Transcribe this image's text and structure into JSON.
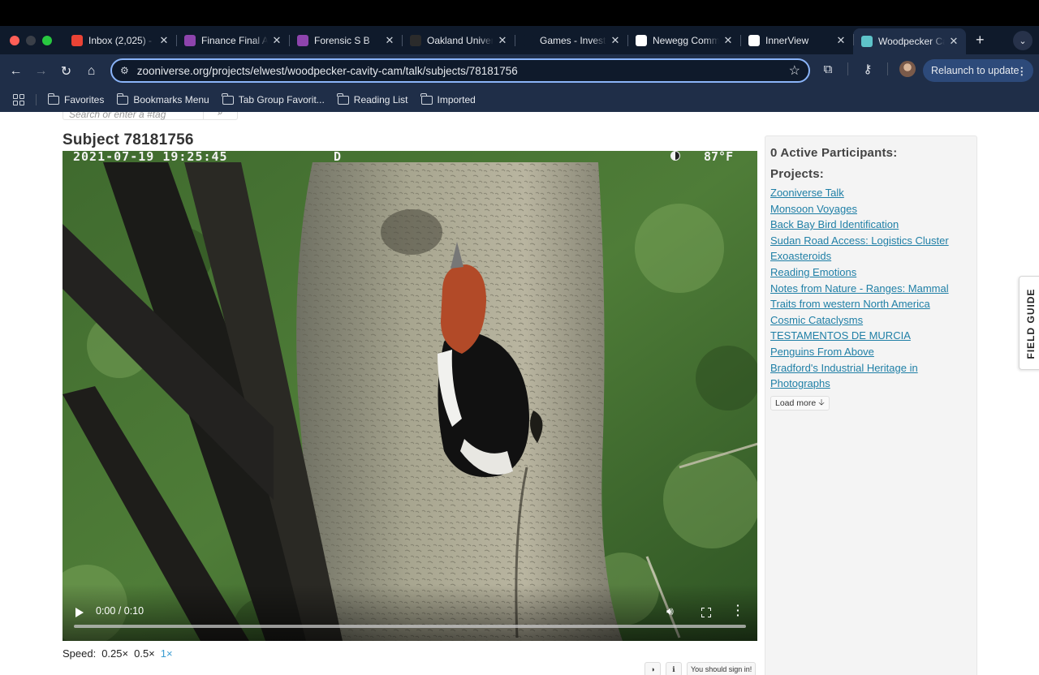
{
  "browser": {
    "tabs": [
      {
        "title": "Inbox (2,025) -",
        "favicon": "gmail-icon",
        "fav_color": "#ea4335"
      },
      {
        "title": "Finance Final A",
        "favicon": "canvas-icon",
        "fav_color": "#8e44ad"
      },
      {
        "title": "Forensic S B",
        "favicon": "canvas-icon",
        "fav_color": "#8e44ad"
      },
      {
        "title": "Oakland Univer",
        "favicon": "oakland-icon",
        "fav_color": "#2b2b2b"
      },
      {
        "title": "Games - Investi",
        "favicon": "investing-icon",
        "fav_color": "#0f1a2b"
      },
      {
        "title": "Newegg Comm",
        "favicon": "newegg-icon",
        "fav_color": "#ffffff"
      },
      {
        "title": "InnerView",
        "favicon": "innerview-icon",
        "fav_color": "#ffffff"
      },
      {
        "title": "Woodpecker Ca",
        "favicon": "zooniverse-icon",
        "fav_color": "#5ec3c9",
        "active": true
      }
    ],
    "new_tab": "+",
    "url": "zooniverse.org/projects/elwest/woodpecker-cavity-cam/talk/subjects/78181756",
    "relaunch_label": "Relaunch to update",
    "bookmarks": [
      "Favorites",
      "Bookmarks Menu",
      "Tab Group Favorit...",
      "Reading List",
      "Imported"
    ]
  },
  "page": {
    "search_placeholder": "Search or enter a #tag",
    "subject_title": "Subject 78181756",
    "video": {
      "timestamp": "2021-07-19 19:25:45",
      "mode": "D",
      "temperature": "87°F",
      "time": "0:00 / 0:10",
      "progress": 0
    },
    "speed": {
      "label": "Speed:",
      "options": [
        "0.25×",
        "0.5×",
        "1×"
      ],
      "selected": "1×"
    },
    "actions": {
      "sign_in": "You should sign in!"
    },
    "sidebar": {
      "participants": "0 Active Participants:",
      "projects_heading": "Projects:",
      "projects": [
        "Zooniverse Talk",
        "Monsoon Voyages",
        "Back Bay Bird Identification",
        "Sudan Road Access: Logistics Cluster",
        "Exoasteroids",
        "Reading Emotions",
        "Notes from Nature - Ranges: Mammal ",
        "Traits from western North America",
        "Cosmic Cataclysms ",
        "TESTAMENTOS DE MURCIA",
        "Penguins From Above",
        "Bradford's Industrial Heritage in ",
        "Photographs"
      ],
      "load_more": "Load more"
    },
    "field_guide": "FIELD GUIDE"
  },
  "colors": {
    "link": "#1f7fa6",
    "accent": "#3b9dd2",
    "chrome_dark": "#1f2e48"
  }
}
